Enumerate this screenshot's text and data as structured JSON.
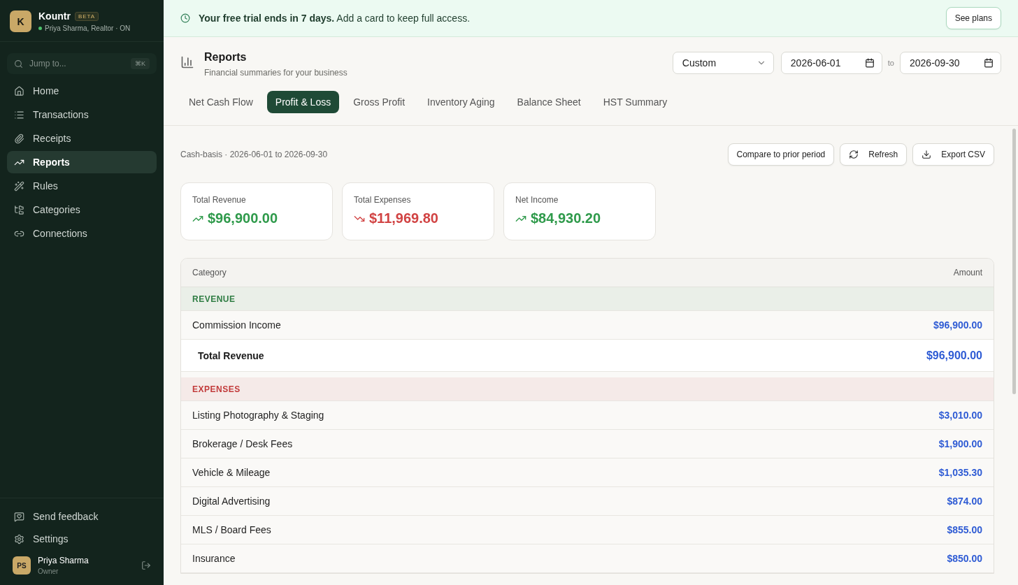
{
  "sidebar": {
    "brand": {
      "initial": "K",
      "name": "Kountr",
      "badge": "BETA",
      "subtitle": "Priya Sharma, Realtor · ON",
      "online": true
    },
    "search": {
      "placeholder": "Jump to...",
      "shortcut": "⌘K"
    },
    "items": [
      {
        "label": "Home",
        "selected": false
      },
      {
        "label": "Transactions",
        "selected": false
      },
      {
        "label": "Receipts",
        "selected": false
      },
      {
        "label": "Reports",
        "selected": true
      },
      {
        "label": "Rules",
        "selected": false
      },
      {
        "label": "Categories",
        "selected": false
      },
      {
        "label": "Connections",
        "selected": false
      }
    ],
    "footer_items": [
      {
        "label": "Send feedback"
      },
      {
        "label": "Settings"
      }
    ],
    "user": {
      "initials": "PS",
      "name": "Priya Sharma",
      "role": "Owner"
    }
  },
  "banner": {
    "text": "**Your free trial ends in 7 days.** Add a card to keep full access.",
    "button": "See plans"
  },
  "header": {
    "title": "Reports",
    "subtitle": "Financial summaries for your business",
    "period": "Custom",
    "from": "2026-06-01",
    "to_label": "to",
    "to": "2026-09-30"
  },
  "tabs": [
    {
      "label": "Net Cash Flow",
      "selected": false
    },
    {
      "label": "Profit & Loss",
      "selected": true
    },
    {
      "label": "Gross Profit",
      "selected": false
    },
    {
      "label": "Inventory Aging",
      "selected": false
    },
    {
      "label": "Balance Sheet",
      "selected": false
    },
    {
      "label": "HST Summary",
      "selected": false
    }
  ],
  "report": {
    "basis": "Cash-basis · 2026-06-01 to 2026-09-30",
    "actions": [
      "Compare to prior period",
      "Refresh",
      "Export CSV"
    ],
    "stats": [
      {
        "label": "Total Revenue",
        "value": "$96,900.00",
        "kind": "up"
      },
      {
        "label": "Total Expenses",
        "value": "$11,969.80",
        "kind": "down"
      },
      {
        "label": "Net Income",
        "value": "$84,930.20",
        "kind": "up"
      }
    ],
    "table": {
      "columns": [
        "Category",
        "Amount"
      ],
      "rows": [
        {
          "kind": "section",
          "label": "REVENUE",
          "color": "#2f7d43"
        },
        {
          "kind": "item",
          "label": "Commission Income",
          "amount": "$96,900.00"
        },
        {
          "kind": "total",
          "label": "Total Revenue",
          "amount": "$96,900.00"
        },
        {
          "kind": "section",
          "label": "EXPENSES",
          "color": "#c23b3b"
        },
        {
          "kind": "item",
          "label": "Listing Photography & Staging",
          "amount": "$3,010.00"
        },
        {
          "kind": "item",
          "label": "Brokerage / Desk Fees",
          "amount": "$1,900.00"
        },
        {
          "kind": "item",
          "label": "Vehicle & Mileage",
          "amount": "$1,035.30"
        },
        {
          "kind": "item",
          "label": "Digital Advertising",
          "amount": "$874.00"
        },
        {
          "kind": "item",
          "label": "MLS / Board Fees",
          "amount": "$855.00"
        },
        {
          "kind": "item",
          "label": "Insurance",
          "amount": "$850.00"
        }
      ]
    }
  }
}
